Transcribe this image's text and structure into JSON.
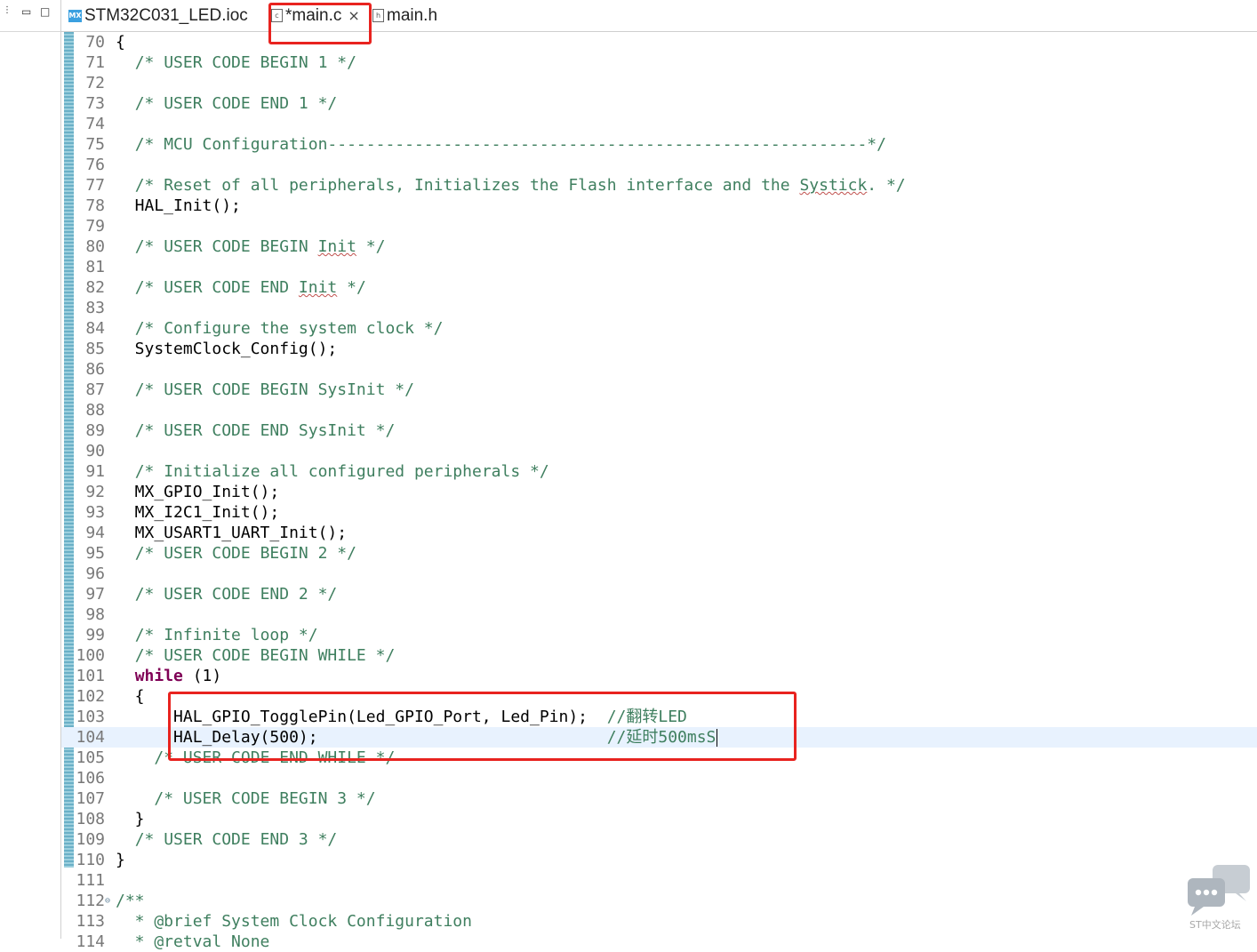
{
  "left_pane": {
    "minimize_glyph": "▭",
    "maximize_glyph": "□"
  },
  "tabs": [
    {
      "label": "STM32C031_LED.ioc",
      "icon": "mx-file-icon",
      "icon_text": "MX"
    },
    {
      "label": "*main.c",
      "icon": "c-file-icon",
      "icon_text": "c",
      "active": true,
      "close": "×"
    },
    {
      "label": "main.h",
      "icon": "h-file-icon",
      "icon_text": "h"
    }
  ],
  "editor": {
    "lines": [
      {
        "n": "70",
        "text": "{"
      },
      {
        "n": "71",
        "text": "  /* USER CODE BEGIN 1 */"
      },
      {
        "n": "72",
        "text": ""
      },
      {
        "n": "73",
        "text": "  /* USER CODE END 1 */"
      },
      {
        "n": "74",
        "text": ""
      },
      {
        "n": "75",
        "text": "  /* MCU Configuration--------------------------------------------------------*/"
      },
      {
        "n": "76",
        "text": ""
      },
      {
        "n": "77",
        "text": "  /* Reset of all peripherals, Initializes the Flash interface and the Systick. */"
      },
      {
        "n": "78",
        "text": "  HAL_Init();"
      },
      {
        "n": "79",
        "text": ""
      },
      {
        "n": "80",
        "text": "  /* USER CODE BEGIN Init */"
      },
      {
        "n": "81",
        "text": ""
      },
      {
        "n": "82",
        "text": "  /* USER CODE END Init */"
      },
      {
        "n": "83",
        "text": ""
      },
      {
        "n": "84",
        "text": "  /* Configure the system clock */"
      },
      {
        "n": "85",
        "text": "  SystemClock_Config();"
      },
      {
        "n": "86",
        "text": ""
      },
      {
        "n": "87",
        "text": "  /* USER CODE BEGIN SysInit */"
      },
      {
        "n": "88",
        "text": ""
      },
      {
        "n": "89",
        "text": "  /* USER CODE END SysInit */"
      },
      {
        "n": "90",
        "text": ""
      },
      {
        "n": "91",
        "text": "  /* Initialize all configured peripherals */"
      },
      {
        "n": "92",
        "text": "  MX_GPIO_Init();"
      },
      {
        "n": "93",
        "text": "  MX_I2C1_Init();"
      },
      {
        "n": "94",
        "text": "  MX_USART1_UART_Init();"
      },
      {
        "n": "95",
        "text": "  /* USER CODE BEGIN 2 */"
      },
      {
        "n": "96",
        "text": ""
      },
      {
        "n": "97",
        "text": "  /* USER CODE END 2 */"
      },
      {
        "n": "98",
        "text": ""
      },
      {
        "n": "99",
        "text": "  /* Infinite loop */"
      },
      {
        "n": "100",
        "text": "  /* USER CODE BEGIN WHILE */"
      },
      {
        "n": "101",
        "text": "  while (1)"
      },
      {
        "n": "102",
        "text": "  {"
      },
      {
        "n": "103",
        "text": "      HAL_GPIO_TogglePin(Led_GPIO_Port, Led_Pin);  //翻转LED"
      },
      {
        "n": "104",
        "text": "      HAL_Delay(500);                              //延时500msS",
        "current": true
      },
      {
        "n": "105",
        "text": "    /* USER CODE END WHILE */"
      },
      {
        "n": "106",
        "text": ""
      },
      {
        "n": "107",
        "text": "    /* USER CODE BEGIN 3 */"
      },
      {
        "n": "108",
        "text": "  }"
      },
      {
        "n": "109",
        "text": "  /* USER CODE END 3 */"
      },
      {
        "n": "110",
        "text": "}"
      },
      {
        "n": "111",
        "text": ""
      },
      {
        "n": "112",
        "text": "/**",
        "fold": "⊖"
      },
      {
        "n": "113",
        "text": "  * @brief System Clock Configuration"
      },
      {
        "n": "114",
        "text": "  * @retval None"
      }
    ]
  },
  "watermark": {
    "text": "ST中文论坛"
  },
  "colors": {
    "highlight_box": "#e8231f",
    "comment": "#3f7f5f",
    "keyword": "#7f0055",
    "current_line": "#e8f2fe"
  }
}
